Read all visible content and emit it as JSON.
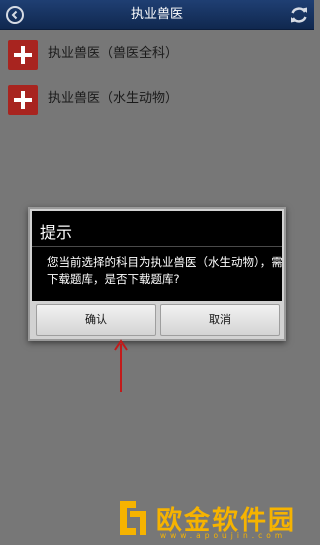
{
  "header": {
    "title": "执业兽医",
    "back_icon": "back-arrow-icon",
    "refresh_icon": "refresh-icon",
    "color": "#1a3563"
  },
  "list": {
    "items": [
      {
        "label": "执业兽医（兽医全科）",
        "icon": "plus-icon"
      },
      {
        "label": "执业兽医（水生动物）",
        "icon": "plus-icon"
      }
    ],
    "icon_color": "#a8241f"
  },
  "dialog": {
    "title": "提示",
    "message": "您当前选择的科目为执业兽医（水生动物），需下载题库，是否下载题库?",
    "confirm_label": "确认",
    "cancel_label": "取消"
  },
  "annotation": {
    "arrow_color": "#c21a1a"
  },
  "watermark": {
    "brand": "欧金软件园",
    "url": "www.apoujin.com",
    "color": "#f6b300"
  }
}
